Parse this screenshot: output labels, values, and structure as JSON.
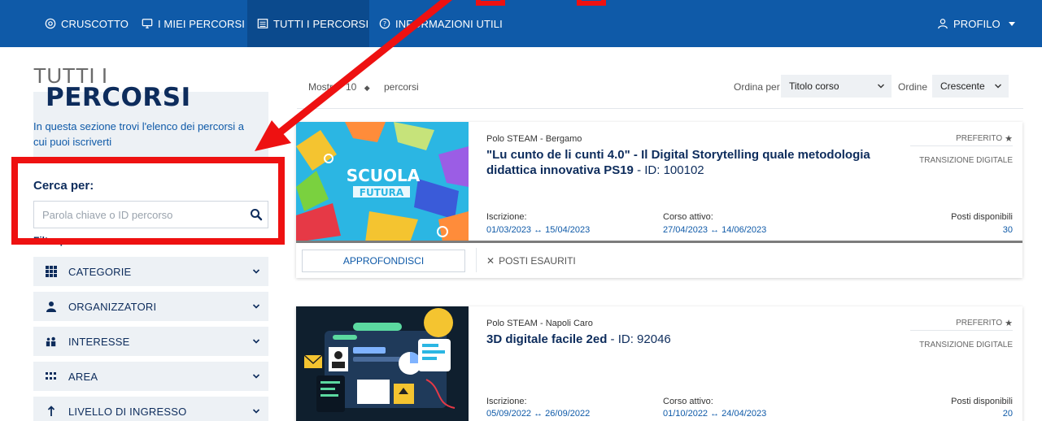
{
  "nav": {
    "items": [
      {
        "label": "CRUSCOTTO",
        "icon": "dashboard-icon"
      },
      {
        "label": "I MIEI PERCORSI",
        "icon": "monitor-icon"
      },
      {
        "label": "TUTTI I PERCORSI",
        "icon": "list-icon",
        "active": true
      },
      {
        "label": "INFORMAZIONI UTILI",
        "icon": "help-icon"
      }
    ],
    "profile_label": "PROFILO"
  },
  "sidebar": {
    "title_line1": "TUTTI I",
    "title_line2": "PERCORSI",
    "intro": "In questa sezione trovi l'elenco dei percorsi a cui puoi iscriverti",
    "search_label": "Cerca per:",
    "search_placeholder": "Parola chiave o ID percorso",
    "filter_label": "Filtra per",
    "filters": [
      {
        "label": "CATEGORIE",
        "icon": "grid-icon"
      },
      {
        "label": "ORGANIZZATORI",
        "icon": "people-icon"
      },
      {
        "label": "INTERESSE",
        "icon": "group-icon"
      },
      {
        "label": "AREA",
        "icon": "dots-grid-icon"
      },
      {
        "label": "LIVELLO DI INGRESSO",
        "icon": "level-up-icon"
      }
    ]
  },
  "toolbar": {
    "show_label": "Mostra",
    "show_value": "10",
    "show_suffix": "percorsi",
    "sort_label": "Ordina per",
    "sort_value": "Titolo corso",
    "order_label": "Ordine",
    "order_value": "Crescente"
  },
  "courses": [
    {
      "organizer": "Polo STEAM - Bergamo",
      "title": "\"Lu cunto de li cunti 4.0\" - Il Digital Storytelling quale metodologia didattica innovativa PS19",
      "id_text": " - ID: 100102",
      "favorite_label": "PREFERITO",
      "category": "TRANSIZIONE DIGITALE",
      "enroll_label": "Iscrizione:",
      "enroll_dates": "01/03/2023 ↔ 15/04/2023",
      "active_label": "Corso attivo:",
      "active_dates": "27/04/2023 ↔ 14/06/2023",
      "seats_label": "Posti disponibili",
      "seats": "30",
      "more_label": "APPROFONDISCI",
      "status": "POSTI ESAURITI",
      "image_text_1": "SCUOLA",
      "image_text_2": "FUTURA"
    },
    {
      "organizer": "Polo STEAM - Napoli Caro",
      "title": "3D digitale facile 2ed",
      "id_text": " - ID: 92046",
      "favorite_label": "PREFERITO",
      "category": "TRANSIZIONE DIGITALE",
      "enroll_label": "Iscrizione:",
      "enroll_dates": "05/09/2022 ↔ 26/09/2022",
      "active_label": "Corso attivo:",
      "active_dates": "01/10/2022 ↔ 24/04/2023",
      "seats_label": "Posti disponibili",
      "seats": "20"
    }
  ],
  "colors": {
    "nav_bg": "#0f5aa8",
    "accent": "#0f5aa8",
    "dark_blue": "#0d2c5c",
    "highlight_red": "#ee1111"
  }
}
